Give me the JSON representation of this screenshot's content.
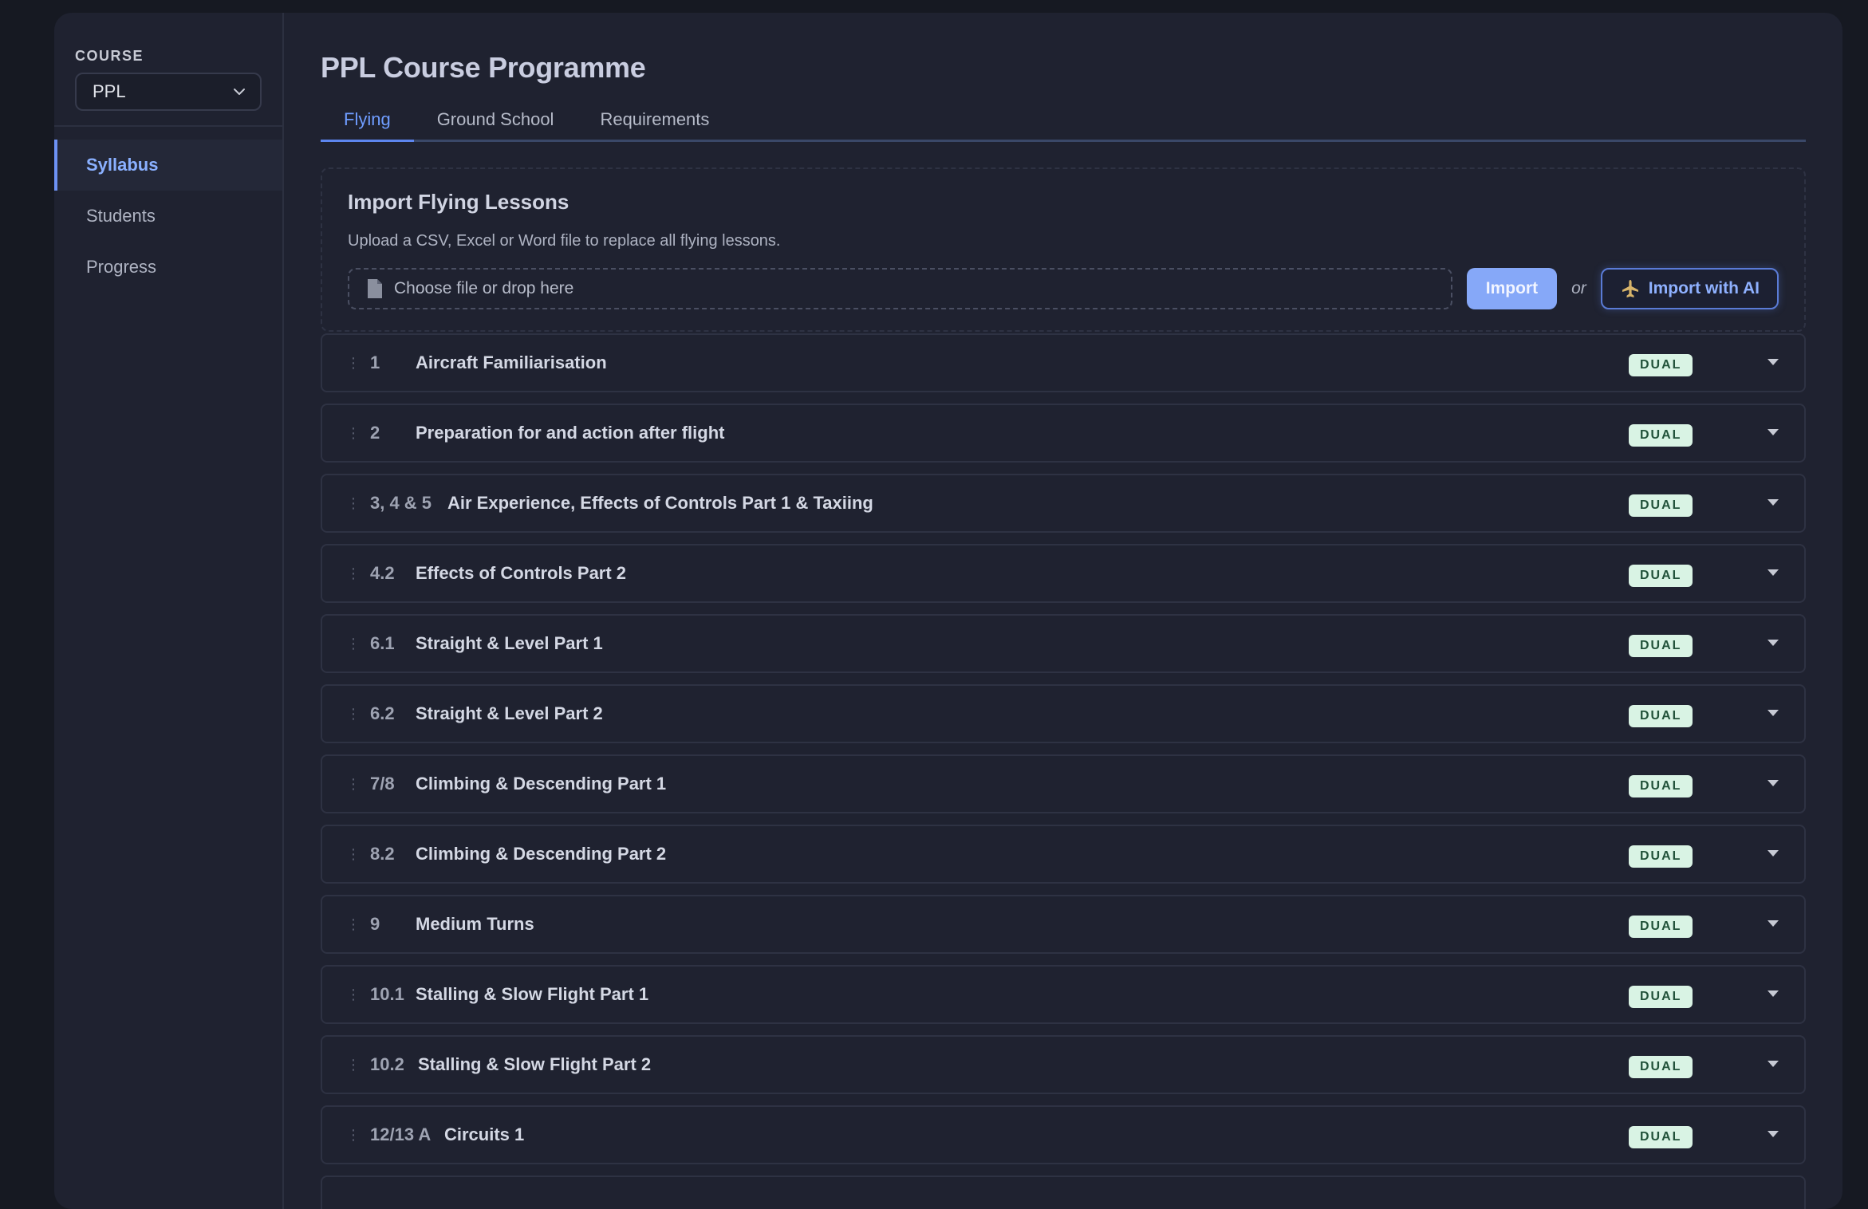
{
  "sidebar": {
    "course_label": "COURSE",
    "course_value": "PPL",
    "nav": [
      {
        "label": "Syllabus",
        "active": true
      },
      {
        "label": "Students",
        "active": false
      },
      {
        "label": "Progress",
        "active": false
      }
    ]
  },
  "main": {
    "title": "PPL Course Programme",
    "tabs": [
      {
        "label": "Flying",
        "active": true
      },
      {
        "label": "Ground School",
        "active": false
      },
      {
        "label": "Requirements",
        "active": false
      }
    ],
    "import": {
      "title": "Import Flying Lessons",
      "description": "Upload a CSV, Excel or Word file to replace all flying lessons.",
      "dropzone_text": "Choose file or drop here",
      "import_button": "Import",
      "or_text": "or",
      "ai_button": "Import with AI"
    },
    "lessons": [
      {
        "num": "1",
        "title": "Aircraft Familiarisation",
        "badge": "DUAL"
      },
      {
        "num": "2",
        "title": "Preparation for and action after flight",
        "badge": "DUAL"
      },
      {
        "num": "3, 4 & 5",
        "title": "Air Experience, Effects of Controls Part 1 & Taxiing",
        "badge": "DUAL"
      },
      {
        "num": "4.2",
        "title": "Effects of Controls Part 2",
        "badge": "DUAL"
      },
      {
        "num": "6.1",
        "title": "Straight & Level Part 1",
        "badge": "DUAL"
      },
      {
        "num": "6.2",
        "title": "Straight & Level Part 2",
        "badge": "DUAL"
      },
      {
        "num": "7/8",
        "title": "Climbing & Descending Part 1",
        "badge": "DUAL"
      },
      {
        "num": "8.2",
        "title": "Climbing & Descending Part 2",
        "badge": "DUAL"
      },
      {
        "num": "9",
        "title": "Medium Turns",
        "badge": "DUAL"
      },
      {
        "num": "10.1",
        "title": "Stalling & Slow Flight Part 1",
        "badge": "DUAL"
      },
      {
        "num": "10.2",
        "title": "Stalling & Slow Flight Part 2",
        "badge": "DUAL"
      },
      {
        "num": "12/13 A",
        "title": "Circuits 1",
        "badge": "DUAL"
      }
    ]
  },
  "colors": {
    "accent": "#6f9dff",
    "badge_bg": "#d9f3e4",
    "badge_text": "#22523a"
  }
}
